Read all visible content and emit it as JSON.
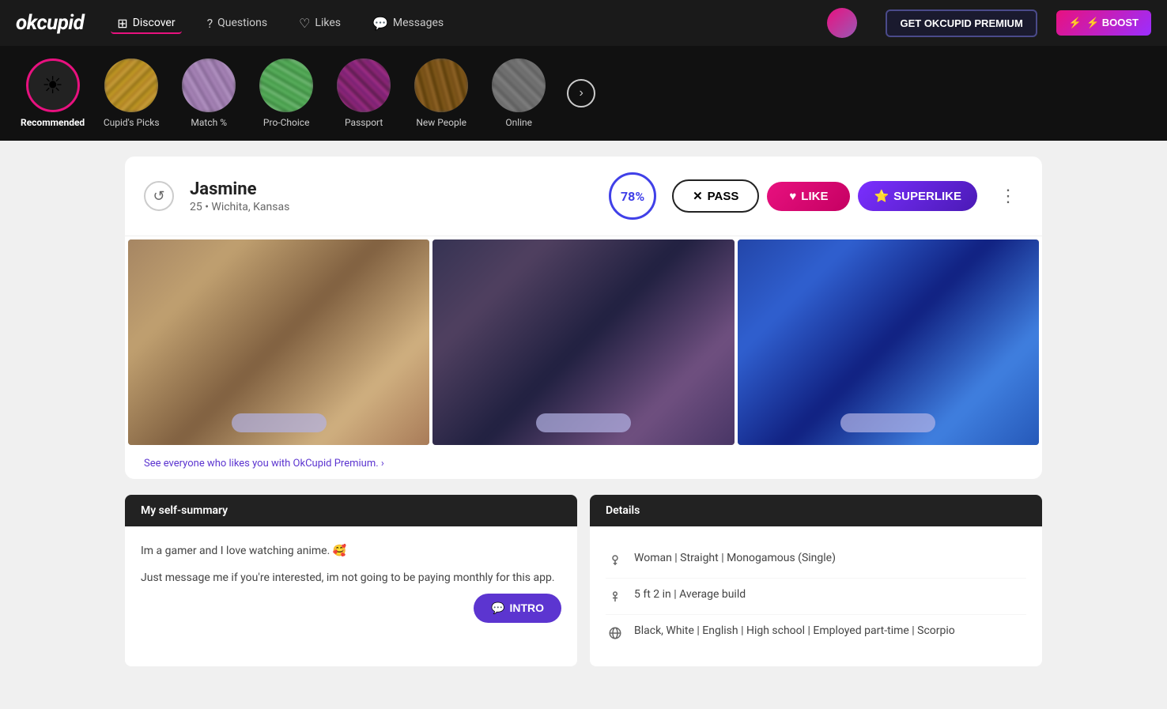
{
  "app": {
    "logo": "okcupid",
    "nav": {
      "items": [
        {
          "id": "discover",
          "label": "Discover",
          "active": true,
          "icon": "grid"
        },
        {
          "id": "questions",
          "label": "Questions",
          "active": false,
          "icon": "question"
        },
        {
          "id": "likes",
          "label": "Likes",
          "active": false,
          "icon": "heart"
        },
        {
          "id": "messages",
          "label": "Messages",
          "active": false,
          "icon": "chat"
        }
      ],
      "premium_btn": "GET OKCUPID PREMIUM",
      "boost_btn": "⚡ BOOST"
    }
  },
  "categories": [
    {
      "id": "recommended",
      "label": "Recommended",
      "active": true,
      "type": "icon"
    },
    {
      "id": "cupids-picks",
      "label": "Cupid's Picks",
      "active": false,
      "type": "image"
    },
    {
      "id": "match",
      "label": "Match %",
      "active": false,
      "type": "image"
    },
    {
      "id": "pro-choice",
      "label": "Pro-Choice",
      "active": false,
      "type": "image"
    },
    {
      "id": "passport",
      "label": "Passport",
      "active": false,
      "type": "image"
    },
    {
      "id": "new-people",
      "label": "New People",
      "active": false,
      "type": "image"
    },
    {
      "id": "online",
      "label": "Online",
      "active": false,
      "type": "image"
    }
  ],
  "profile": {
    "name": "Jasmine",
    "age": "25",
    "location": "Wichita, Kansas",
    "age_location": "25 • Wichita, Kansas",
    "match_percent": "78%",
    "actions": {
      "pass": "PASS",
      "like": "LIKE",
      "superlike": "SUPERLIKE"
    },
    "premium_link": "See everyone who likes you with OkCupid Premium. ›",
    "self_summary": {
      "header": "My self-summary",
      "text1": "Im a gamer and I love watching anime. 🥰",
      "text2": "Just message me if you're interested, im not going to be paying monthly for this app."
    },
    "details": {
      "header": "Details",
      "items": [
        {
          "icon": "person",
          "text": "Woman | Straight | Monogamous (Single)"
        },
        {
          "icon": "height",
          "text": "5 ft 2 in | Average build"
        },
        {
          "icon": "globe",
          "text": "Black, White | English | High school | Employed part-time | Scorpio"
        }
      ]
    },
    "intro_btn": "INTRO"
  }
}
